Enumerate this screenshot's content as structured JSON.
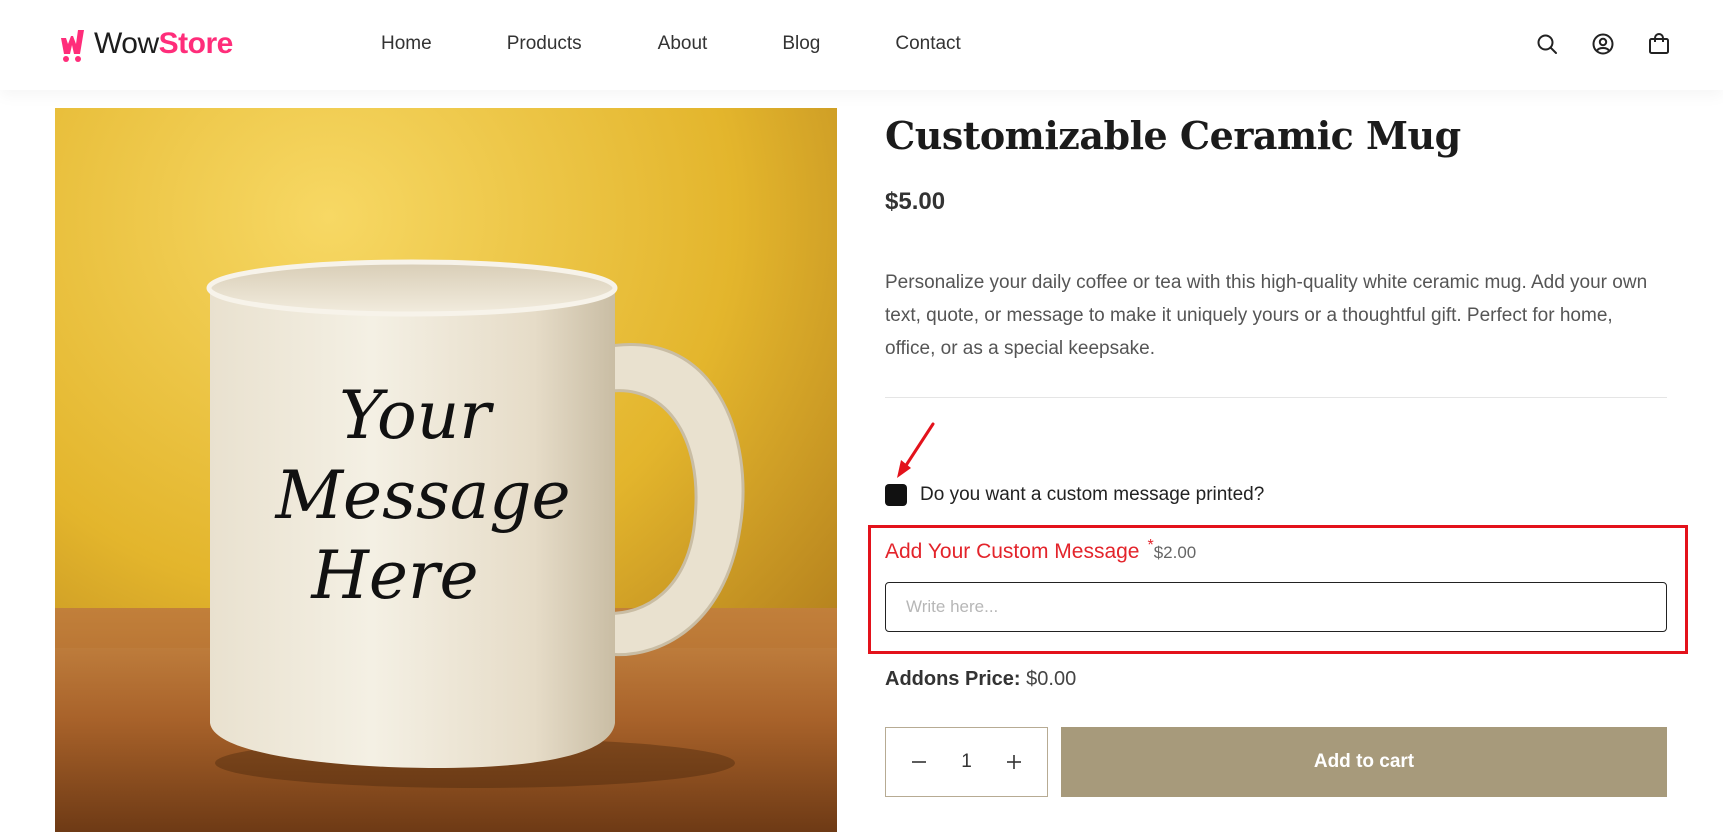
{
  "brand": {
    "name_part1": "Wow",
    "name_part2": "Store",
    "accent_color": "#ff2d7a"
  },
  "nav": {
    "items": [
      "Home",
      "Products",
      "About",
      "Blog",
      "Contact"
    ]
  },
  "header_icons": [
    "search-icon",
    "user-icon",
    "cart-icon"
  ],
  "product": {
    "image_text_line1": "Your",
    "image_text_line2": "Message",
    "image_text_line3": "Here",
    "title": "Customizable Ceramic Mug",
    "price": "$5.00",
    "description": "Personalize your daily coffee or tea with this high-quality white ceramic mug. Add your own text, quote, or message to make it uniquely yours or a thoughtful gift. Perfect for home, office, or as a special keepsake."
  },
  "addon": {
    "checkbox_label": "Do you want a custom message printed?",
    "checkbox_checked": true,
    "field_label": "Add Your Custom Message",
    "required_mark": "*",
    "field_price": "$2.00",
    "input_value": "",
    "input_placeholder": "Write here...",
    "highlight_color": "#e3121b"
  },
  "summary": {
    "addons_price_label": "Addons Price:",
    "addons_price_value": "$0.00"
  },
  "cart": {
    "quantity": "1",
    "add_to_cart_label": "Add to cart",
    "button_color": "#a79a7b"
  }
}
